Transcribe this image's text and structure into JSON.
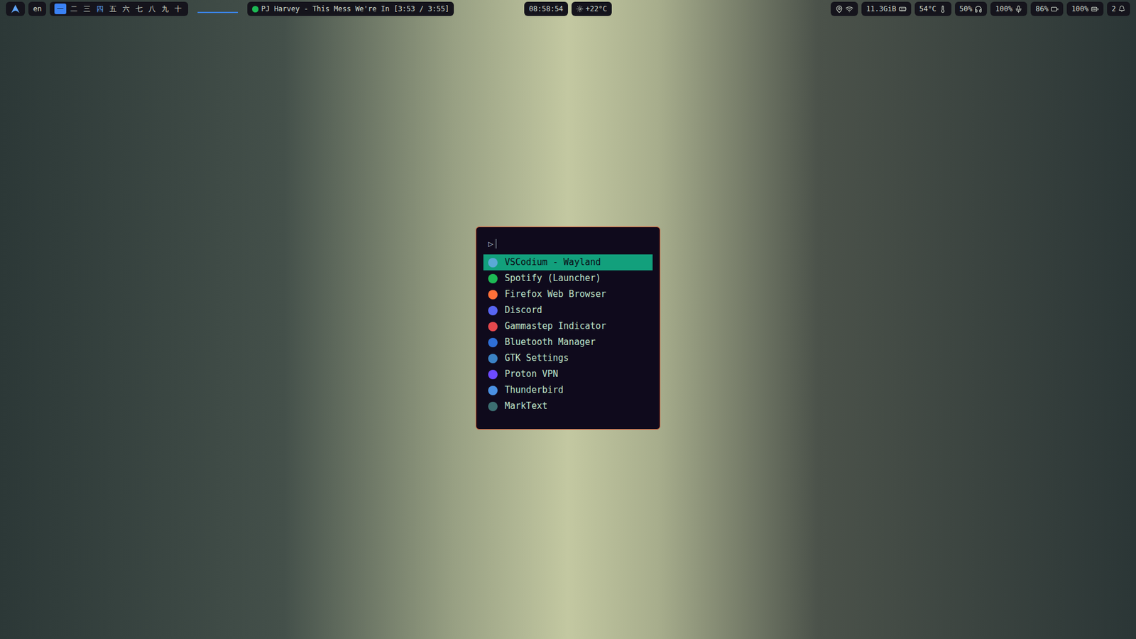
{
  "top_bar": {
    "language": "en",
    "workspaces": [
      {
        "label": "一",
        "selected": true,
        "occupied": true
      },
      {
        "label": "二",
        "selected": false,
        "occupied": false
      },
      {
        "label": "三",
        "selected": false,
        "occupied": false
      },
      {
        "label": "四",
        "selected": false,
        "occupied": true
      },
      {
        "label": "五",
        "selected": false,
        "occupied": false
      },
      {
        "label": "六",
        "selected": false,
        "occupied": false
      },
      {
        "label": "七",
        "selected": false,
        "occupied": false
      },
      {
        "label": "八",
        "selected": false,
        "occupied": false
      },
      {
        "label": "九",
        "selected": false,
        "occupied": false
      },
      {
        "label": "十",
        "selected": false,
        "occupied": false
      }
    ],
    "media": {
      "text": "PJ Harvey - This Mess We're In [3:53 / 3:55]"
    },
    "clock": "08:58:54",
    "weather": "+22°C",
    "status": [
      {
        "text": "11.3GiB",
        "kind": "memory"
      },
      {
        "text": "54°C",
        "kind": "temperature"
      },
      {
        "text": "50%",
        "kind": "headphones"
      },
      {
        "text": "100%",
        "kind": "microphone"
      },
      {
        "text": "86%",
        "kind": "battery"
      },
      {
        "text": "100%",
        "kind": "battery-full"
      }
    ],
    "notifications": "2"
  },
  "launcher": {
    "prompt_icon": "▷",
    "query": "",
    "items": [
      {
        "label": "VSCodium - Wayland",
        "selected": true,
        "color": "#5aa9d6"
      },
      {
        "label": "Spotify (Launcher)",
        "selected": false,
        "color": "#1db954"
      },
      {
        "label": "Firefox Web Browser",
        "selected": false,
        "color": "#ff7139"
      },
      {
        "label": "Discord",
        "selected": false,
        "color": "#5865f2"
      },
      {
        "label": "Gammastep Indicator",
        "selected": false,
        "color": "#e5484d"
      },
      {
        "label": "Bluetooth Manager",
        "selected": false,
        "color": "#2f6fd6"
      },
      {
        "label": "GTK Settings",
        "selected": false,
        "color": "#3b82c4"
      },
      {
        "label": "Proton VPN",
        "selected": false,
        "color": "#6d4aff"
      },
      {
        "label": "Thunderbird",
        "selected": false,
        "color": "#4a90e2"
      },
      {
        "label": "MarkText",
        "selected": false,
        "color": "#3c6e71"
      }
    ]
  }
}
